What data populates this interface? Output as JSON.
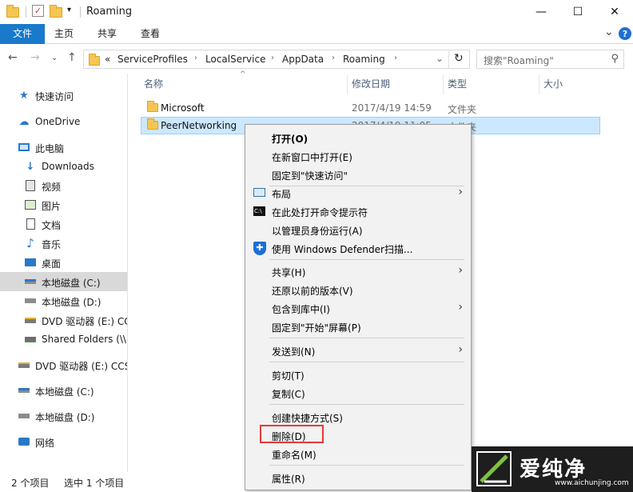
{
  "window": {
    "title": "Roaming",
    "minimize": "—",
    "maximize": "☐",
    "close": "✕"
  },
  "ribbon": {
    "tabs": [
      "文件",
      "主页",
      "共享",
      "查看"
    ],
    "expand": "⌄",
    "help": "?"
  },
  "address": {
    "overflow": "«",
    "crumbs": [
      "ServiceProfiles",
      "LocalService",
      "AppData",
      "Roaming"
    ],
    "refresh": "↻",
    "search_placeholder": "搜索\"Roaming\""
  },
  "sidebar": {
    "items": [
      {
        "label": "快速访问",
        "icon": "star-icon"
      },
      {
        "label": "OneDrive",
        "icon": "cloud-icon"
      },
      {
        "label": "此电脑",
        "icon": "computer-icon"
      },
      {
        "label": "Downloads",
        "icon": "download-icon"
      },
      {
        "label": "视频",
        "icon": "video-icon"
      },
      {
        "label": "图片",
        "icon": "picture-icon"
      },
      {
        "label": "文档",
        "icon": "document-icon"
      },
      {
        "label": "音乐",
        "icon": "music-icon"
      },
      {
        "label": "桌面",
        "icon": "desktop-icon"
      },
      {
        "label": "本地磁盘 (C:)",
        "icon": "drive-icon"
      },
      {
        "label": "本地磁盘 (D:)",
        "icon": "drive-icon"
      },
      {
        "label": "DVD 驱动器 (E:) CC",
        "icon": "dvd-icon"
      },
      {
        "label": "Shared Folders (\\\\",
        "icon": "network-drive-icon"
      },
      {
        "label": "DVD 驱动器 (E:) CCS",
        "icon": "dvd-icon"
      },
      {
        "label": "本地磁盘 (C:)",
        "icon": "drive-icon"
      },
      {
        "label": "本地磁盘 (D:)",
        "icon": "drive-icon"
      },
      {
        "label": "网络",
        "icon": "network-icon"
      }
    ]
  },
  "columns": {
    "name": "名称",
    "date": "修改日期",
    "type": "类型",
    "size": "大小"
  },
  "files": [
    {
      "name": "Microsoft",
      "date": "2017/4/19 14:59",
      "type": "文件夹"
    },
    {
      "name": "PeerNetworking",
      "date": "2017/4/19 11:05",
      "type": "文件夹"
    }
  ],
  "status": {
    "count": "2 个项目",
    "selected": "选中 1 个项目"
  },
  "context_menu": {
    "items": [
      {
        "label": "打开(O)",
        "bold": true
      },
      {
        "label": "在新窗口中打开(E)"
      },
      {
        "label": "固定到\"快速访问\""
      },
      {
        "label": "布局",
        "submenu": true
      },
      {
        "label": "在此处打开命令提示符"
      },
      {
        "label": "以管理员身份运行(A)"
      },
      {
        "label": "使用 Windows Defender扫描..."
      },
      {
        "label": "共享(H)",
        "submenu": true
      },
      {
        "label": "还原以前的版本(V)"
      },
      {
        "label": "包含到库中(I)",
        "submenu": true
      },
      {
        "label": "固定到\"开始\"屏幕(P)"
      },
      {
        "label": "发送到(N)",
        "submenu": true
      },
      {
        "label": "剪切(T)"
      },
      {
        "label": "复制(C)"
      },
      {
        "label": "创建快捷方式(S)"
      },
      {
        "label": "删除(D)"
      },
      {
        "label": "重命名(M)"
      },
      {
        "label": "属性(R)"
      }
    ],
    "arrow": "›"
  },
  "watermark": {
    "text": "爱纯净",
    "url": "www.aichunjing.com"
  },
  "colors": {
    "accent": "#1979ca",
    "selection": "#cce8ff",
    "highlight_box": "#e53a3a"
  }
}
